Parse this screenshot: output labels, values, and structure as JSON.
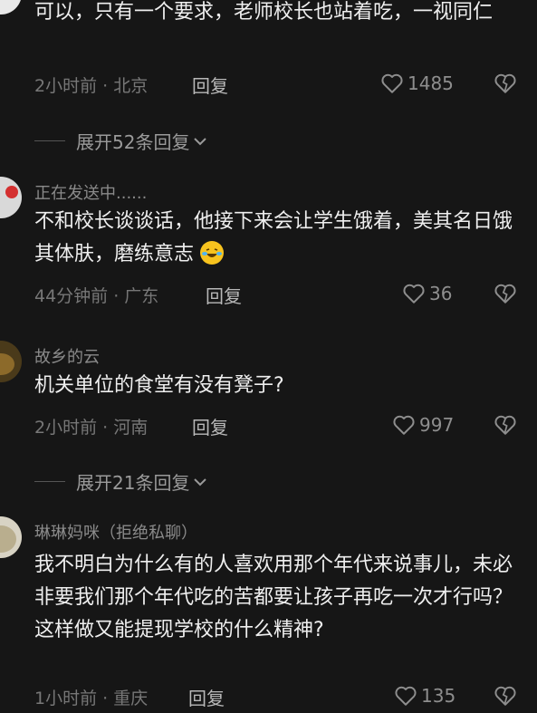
{
  "comments": [
    {
      "username": "",
      "text": "可以，只有一个要求，老师校长也站着吃，一视同仁",
      "meta": "2小时前 · 北京",
      "reply_label": "回复",
      "likes": "1485",
      "expand": "展开52条回复"
    },
    {
      "username": "正在发送中......",
      "text": "不和校长谈谈话，他接下来会让学生饿着，美其名日饿其体肤，磨练意志",
      "emoji": "laughing-tears-emoji",
      "meta": "44分钟前 · 广东",
      "reply_label": "回复",
      "likes": "36"
    },
    {
      "username": "故乡的云",
      "text": "机关单位的食堂有没有凳子?",
      "meta": "2小时前 · 河南",
      "reply_label": "回复",
      "likes": "997",
      "expand": "展开21条回复"
    },
    {
      "username": "琳琳妈咪（拒绝私聊）",
      "text": "我不明白为什么有的人喜欢用那个年代来说事儿，未必非要我们那个年代吃的苦都要让孩子再吃一次才行吗？这样做又能提现学校的什么精神?",
      "meta": "1小时前 · 重庆",
      "reply_label": "回复",
      "likes": "135"
    }
  ],
  "icons": {
    "like": "heart-outline-icon",
    "dislike": "broken-heart-icon",
    "expand": "chevron-down-icon"
  },
  "colors": {
    "background": "#161616",
    "text": "#efefef",
    "muted": "#8a8a8a"
  }
}
